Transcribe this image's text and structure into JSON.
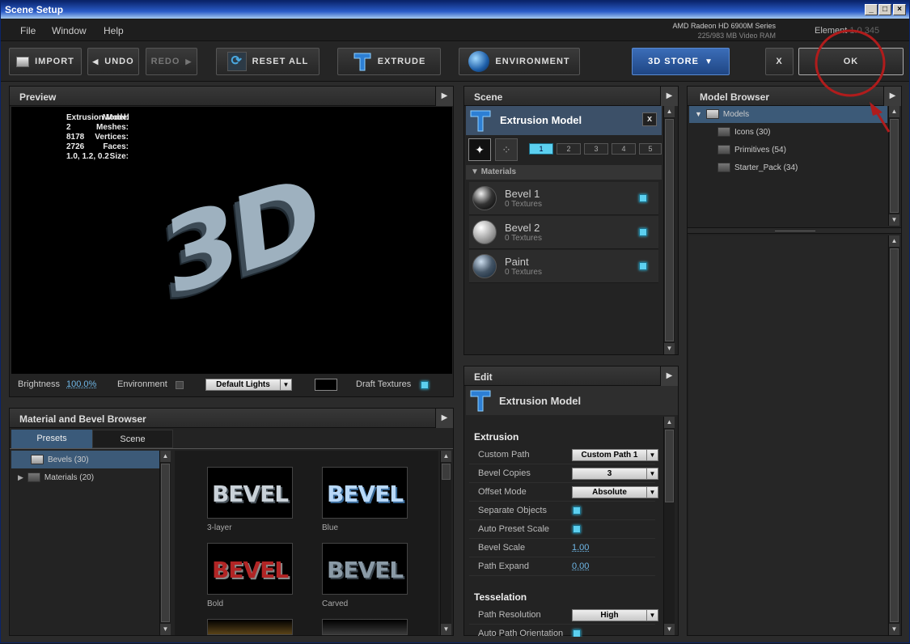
{
  "window": {
    "title": "Scene Setup"
  },
  "menu": [
    "File",
    "Window",
    "Help"
  ],
  "gpu": {
    "name": "AMD Radeon HD 6900M Series",
    "ram": "225/983 MB Video RAM"
  },
  "element": {
    "label": "Element",
    "version": "1.0.345"
  },
  "toolbar": {
    "import": "IMPORT",
    "undo": "UNDO",
    "redo": "REDO",
    "reset": "RESET ALL",
    "extrude": "EXTRUDE",
    "environment": "ENVIRONMENT",
    "store": "3D STORE",
    "close": "X",
    "ok": "OK"
  },
  "preview": {
    "title": "Preview",
    "info_labels": [
      "Model:",
      "Meshes:",
      "Vertices:",
      "Faces:",
      "Size:"
    ],
    "info_values": [
      "Extrusion Model",
      "2",
      "8178",
      "2726",
      "1.0, 1.2, 0.2"
    ],
    "model_text": "3D",
    "brightness_label": "Brightness",
    "brightness_value": "100.0%",
    "environment_label": "Environment",
    "lights": "Default Lights",
    "draft_label": "Draft Textures"
  },
  "material_browser": {
    "title": "Material and Bevel Browser",
    "tabs": [
      "Presets",
      "Scene"
    ],
    "tree": [
      "Bevels (30)",
      "Materials (20)"
    ],
    "items": [
      {
        "name": "3-layer",
        "text": "BEVEL",
        "color": "#c9d1d8"
      },
      {
        "name": "Blue",
        "text": "BEVEL",
        "color": "#b8d8f8"
      },
      {
        "name": "Bold",
        "text": "BEVEL",
        "color": "#b12525"
      },
      {
        "name": "Carved",
        "text": "BEVEL",
        "color": "#8a9aa6"
      }
    ]
  },
  "scene": {
    "title": "Scene",
    "model": "Extrusion Model",
    "close": "x",
    "layers": [
      "1",
      "2",
      "3",
      "4",
      "5"
    ],
    "materials_label": "Materials",
    "materials": [
      {
        "name": "Bevel 1",
        "sub": "0 Textures"
      },
      {
        "name": "Bevel 2",
        "sub": "0 Textures"
      },
      {
        "name": "Paint",
        "sub": "0 Textures"
      }
    ]
  },
  "edit": {
    "title": "Edit",
    "model": "Extrusion Model",
    "extrusion_heading": "Extrusion",
    "custom_path_label": "Custom Path",
    "custom_path_value": "Custom Path 1",
    "bevel_copies_label": "Bevel Copies",
    "bevel_copies_value": "3",
    "offset_mode_label": "Offset Mode",
    "offset_mode_value": "Absolute",
    "separate_label": "Separate Objects",
    "auto_preset_label": "Auto Preset Scale",
    "bevel_scale_label": "Bevel Scale",
    "bevel_scale_value": "1.00",
    "path_expand_label": "Path Expand",
    "path_expand_value": "0.00",
    "tesselation_heading": "Tesselation",
    "path_res_label": "Path Resolution",
    "path_res_value": "High",
    "auto_path_label": "Auto Path Orientation"
  },
  "model_browser": {
    "title": "Model Browser",
    "root": "Models",
    "items": [
      "Icons (30)",
      "Primitives (54)",
      "Starter_Pack (34)"
    ]
  },
  "colors": {
    "accent": "#5cd0f0",
    "store": "#2c5aa0",
    "annotation": "#b01c1c"
  }
}
